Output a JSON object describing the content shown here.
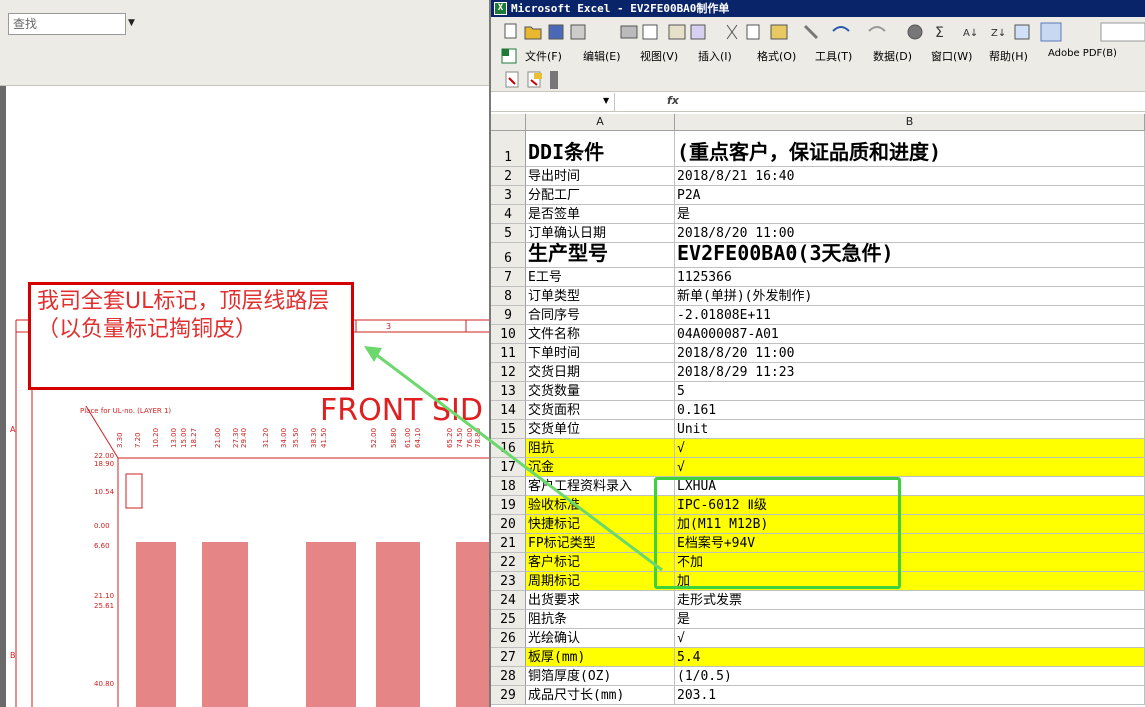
{
  "viewer": {
    "search_placeholder": "查找",
    "drawing_strip_number": "3",
    "drawing_title": "FRONT SID",
    "drawing_note": "Place for UL-no. (LAYER 1)",
    "row_letter_a": "A",
    "row_letter_b": "B",
    "left_axis_values": [
      "22.00",
      "18.90",
      "10.54",
      "0.00",
      "6.60",
      "21.10",
      "25.61",
      "40.80"
    ],
    "top_axis_values": [
      "3.30",
      "7.20",
      "10.20",
      "13.00",
      "15.00",
      "18.27",
      "21.00",
      "27.30",
      "29.40",
      "31.20",
      "34.00",
      "35.50",
      "38.30",
      "41.50",
      "52.00",
      "58.80",
      "61.00",
      "64.10",
      "65.20",
      "74.50",
      "76.00",
      "78.80"
    ]
  },
  "annotation": {
    "text": "我司全套UL标记，顶层线路层（以负量标记掏铜皮）"
  },
  "excel": {
    "title": "Microsoft Excel - EV2FE00BA0制作单",
    "menus": [
      "文件(F)",
      "编辑(E)",
      "视图(V)",
      "插入(I)",
      "格式(O)",
      "工具(T)",
      "数据(D)",
      "窗口(W)",
      "帮助(H)",
      "Adobe PDF(B)"
    ],
    "formula_label": "fx",
    "col_a": "A",
    "col_b": "B",
    "rows": [
      {
        "n": "1",
        "a": "DDI条件",
        "b": "(重点客户，保证品质和进度)",
        "big": true,
        "yellow": false
      },
      {
        "n": "2",
        "a": "导出时间",
        "b": "2018/8/21 16:40",
        "big": false,
        "yellow": false
      },
      {
        "n": "3",
        "a": "分配工厂",
        "b": "P2A",
        "big": false,
        "yellow": false
      },
      {
        "n": "4",
        "a": "是否签单",
        "b": "是",
        "big": false,
        "yellow": false
      },
      {
        "n": "5",
        "a": "订单确认日期",
        "b": "2018/8/20 11:00",
        "big": false,
        "yellow": false
      },
      {
        "n": "6",
        "a": "生产型号",
        "b": "EV2FE00BA0(3天急件)",
        "big": true,
        "yellow": false
      },
      {
        "n": "7",
        "a": "E工号",
        "b": "1125366",
        "big": false,
        "yellow": false
      },
      {
        "n": "8",
        "a": "订单类型",
        "b": "新单(单拼)(外发制作)",
        "big": false,
        "yellow": false
      },
      {
        "n": "9",
        "a": "合同序号",
        "b": "-2.01808E+11",
        "big": false,
        "yellow": false
      },
      {
        "n": "10",
        "a": "文件名称",
        "b": "04A000087-A01",
        "big": false,
        "yellow": false
      },
      {
        "n": "11",
        "a": "下单时间",
        "b": "2018/8/20 11:00",
        "big": false,
        "yellow": false
      },
      {
        "n": "12",
        "a": "交货日期",
        "b": "2018/8/29 11:23",
        "big": false,
        "yellow": false
      },
      {
        "n": "13",
        "a": "交货数量",
        "b": "5",
        "big": false,
        "yellow": false
      },
      {
        "n": "14",
        "a": "交货面积",
        "b": "0.161",
        "big": false,
        "yellow": false
      },
      {
        "n": "15",
        "a": "交货单位",
        "b": "Unit",
        "big": false,
        "yellow": false
      },
      {
        "n": "16",
        "a": "阻抗",
        "b": "√",
        "big": false,
        "yellow": true
      },
      {
        "n": "17",
        "a": "沉金",
        "b": "√",
        "big": false,
        "yellow": true
      },
      {
        "n": "18",
        "a": "客户工程资料录入",
        "b": "LXHUA",
        "big": false,
        "yellow": false
      },
      {
        "n": "19",
        "a": "验收标准",
        "b": "IPC-6012 Ⅱ级",
        "big": false,
        "yellow": true
      },
      {
        "n": "20",
        "a": "快捷标记",
        "b": "加(M11 M12B)",
        "big": false,
        "yellow": true
      },
      {
        "n": "21",
        "a": "FP标记类型",
        "b": "E档案号+94V",
        "big": false,
        "yellow": true
      },
      {
        "n": "22",
        "a": "客户标记",
        "b": "不加",
        "big": false,
        "yellow": true
      },
      {
        "n": "23",
        "a": "周期标记",
        "b": "加",
        "big": false,
        "yellow": true
      },
      {
        "n": "24",
        "a": "出货要求",
        "b": "走形式发票",
        "big": false,
        "yellow": false
      },
      {
        "n": "25",
        "a": "阻抗条",
        "b": "是",
        "big": false,
        "yellow": false
      },
      {
        "n": "26",
        "a": "光绘确认",
        "b": "√",
        "big": false,
        "yellow": false
      },
      {
        "n": "27",
        "a": "板厚(mm)",
        "b": "5.4",
        "big": false,
        "yellow": true
      },
      {
        "n": "28",
        "a": "铜箔厚度(OZ)",
        "b": "(1/0.5)",
        "big": false,
        "yellow": false
      },
      {
        "n": "29",
        "a": "成品尺寸长(mm)",
        "b": "203.1",
        "big": false,
        "yellow": false
      }
    ]
  }
}
